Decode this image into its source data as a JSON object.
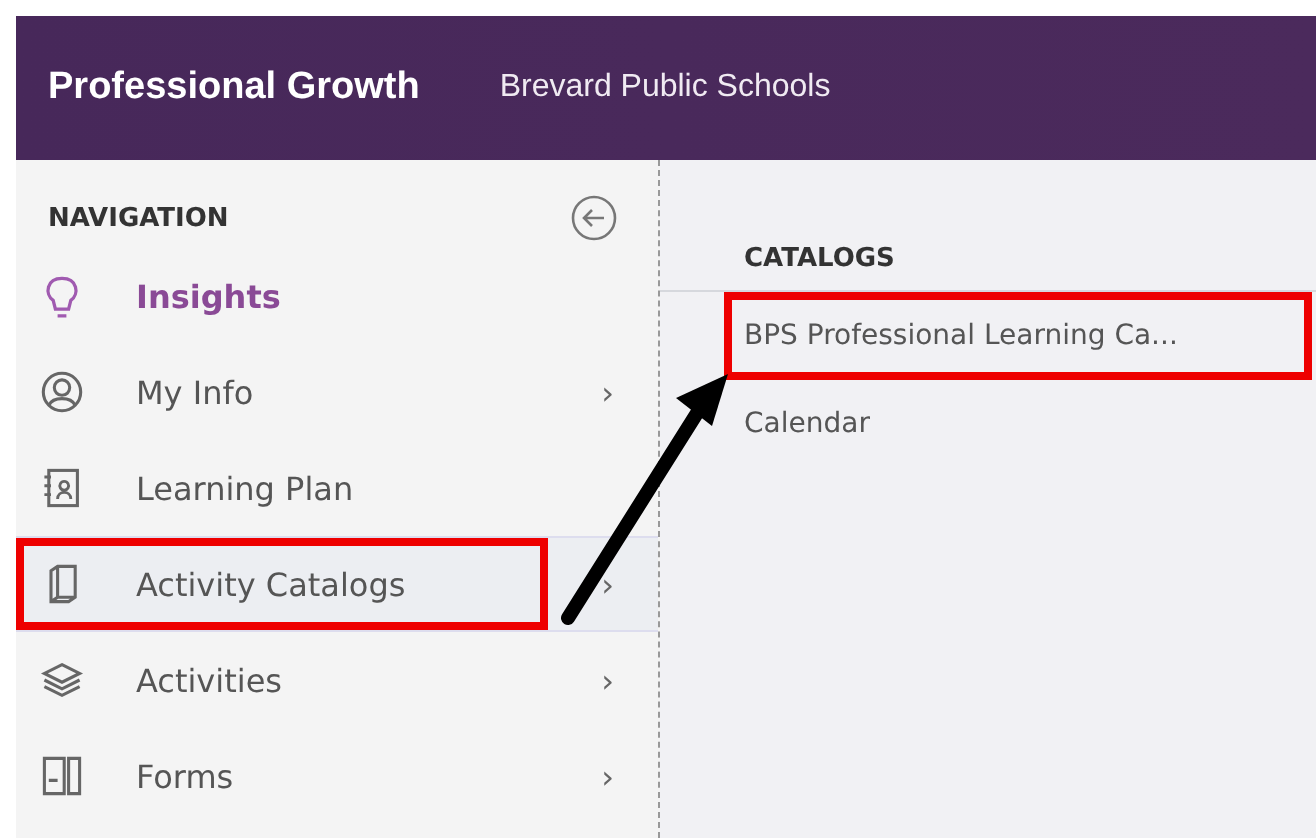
{
  "header": {
    "title": "Professional Growth",
    "organization": "Brevard Public Schools"
  },
  "navigation": {
    "heading": "NAVIGATION",
    "items": [
      {
        "kind": "bulb",
        "label": "Insights",
        "selected": true,
        "highlighted": false
      },
      {
        "kind": "person",
        "label": "My Info",
        "selected": false,
        "chevron": "›",
        "highlighted": false
      },
      {
        "kind": "plan",
        "label": "Learning Plan",
        "selected": false,
        "highlighted": false
      },
      {
        "kind": "book",
        "label": "Activity Catalogs",
        "selected": false,
        "chevron": "›",
        "highlighted": true
      },
      {
        "kind": "layers",
        "label": "Activities",
        "selected": false,
        "chevron": "›",
        "highlighted": false
      },
      {
        "kind": "form",
        "label": "Forms",
        "selected": false,
        "chevron": "›",
        "highlighted": false
      }
    ]
  },
  "catalogs": {
    "heading": "CATALOGS",
    "items": [
      {
        "label": "BPS Professional Learning Ca...",
        "highlighted": true
      },
      {
        "label": "Calendar",
        "highlighted": false
      }
    ]
  }
}
